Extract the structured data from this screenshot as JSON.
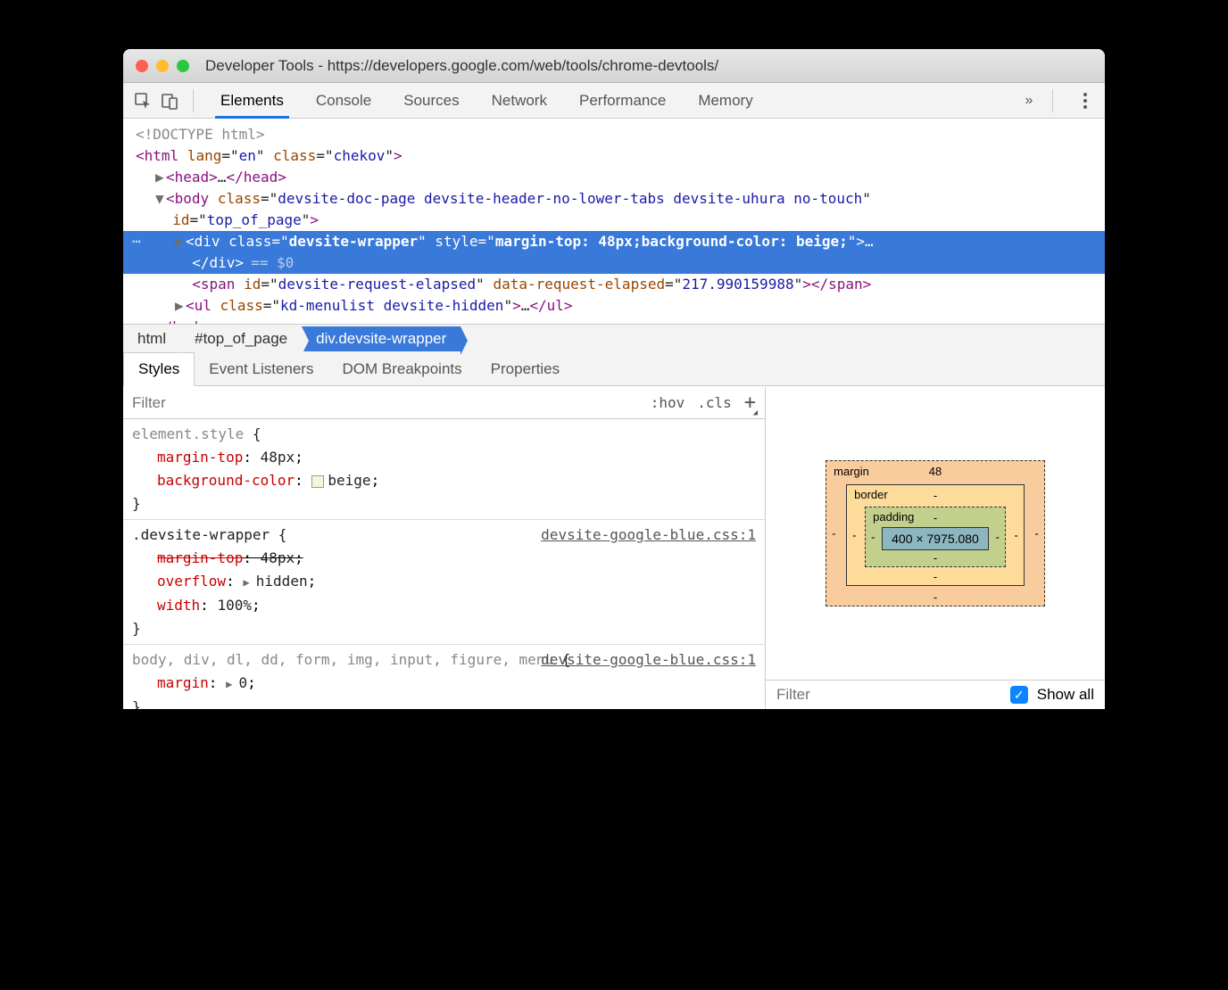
{
  "window": {
    "title": "Developer Tools - https://developers.google.com/web/tools/chrome-devtools/"
  },
  "tabs": [
    "Elements",
    "Console",
    "Sources",
    "Network",
    "Performance",
    "Memory"
  ],
  "activeTab": "Elements",
  "dom": {
    "doctype": "<!DOCTYPE html>",
    "html_open": "<html lang=\"en\" class=\"chekov\">",
    "head": "<head>…</head>",
    "body_open": "<body class=\"devsite-doc-page devsite-header-no-lower-tabs devsite-uhura no-touch\" id=\"top_of_page\">",
    "selected": "<div class=\"devsite-wrapper\" style=\"margin-top: 48px;background-color: beige;\">…</div>",
    "dollar0": "== $0",
    "span": "<span id=\"devsite-request-elapsed\" data-request-elapsed=\"217.990159988\"></span>",
    "ul": "<ul class=\"kd-menulist devsite-hidden\">…</ul>",
    "body_close": "</body>"
  },
  "breadcrumbs": [
    "html",
    "#top_of_page",
    "div.devsite-wrapper"
  ],
  "activeBreadcrumb": "div.devsite-wrapper",
  "subtabs": [
    "Styles",
    "Event Listeners",
    "DOM Breakpoints",
    "Properties"
  ],
  "activeSubtab": "Styles",
  "filter": {
    "placeholder": "Filter",
    "hov": ":hov",
    "cls": ".cls"
  },
  "rules": [
    {
      "selector": "element.style",
      "dark": false,
      "props": [
        {
          "name": "margin-top",
          "val": "48px",
          "strike": false,
          "swatch": false,
          "tri": false
        },
        {
          "name": "background-color",
          "val": "beige",
          "strike": false,
          "swatch": true,
          "tri": false
        }
      ],
      "source": null
    },
    {
      "selector": ".devsite-wrapper",
      "dark": true,
      "props": [
        {
          "name": "margin-top",
          "val": "48px",
          "strike": true,
          "swatch": false,
          "tri": false
        },
        {
          "name": "overflow",
          "val": "hidden",
          "strike": false,
          "swatch": false,
          "tri": true
        },
        {
          "name": "width",
          "val": "100%",
          "strike": false,
          "swatch": false,
          "tri": false
        }
      ],
      "source": "devsite-google-blue.css:1"
    },
    {
      "selector": "body, div, dl, dd, form, img, input, figure, menu",
      "dark": false,
      "props": [
        {
          "name": "margin",
          "val": "0",
          "strike": false,
          "swatch": false,
          "tri": true
        }
      ],
      "source": "devsite-google-blue.css:1"
    }
  ],
  "boxModel": {
    "marginLabel": "margin",
    "borderLabel": "border",
    "paddingLabel": "padding",
    "marginTop": "48",
    "marginRight": "-",
    "marginBottom": "-",
    "marginLeft": "-",
    "borderTop": "-",
    "borderRight": "-",
    "borderBottom": "-",
    "borderLeft": "-",
    "paddingTop": "-",
    "paddingRight": "-",
    "paddingBottom": "-",
    "paddingLeft": "-",
    "content": "400 × 7975.080"
  },
  "computedFilter": {
    "placeholder": "Filter",
    "showAll": "Show all"
  }
}
